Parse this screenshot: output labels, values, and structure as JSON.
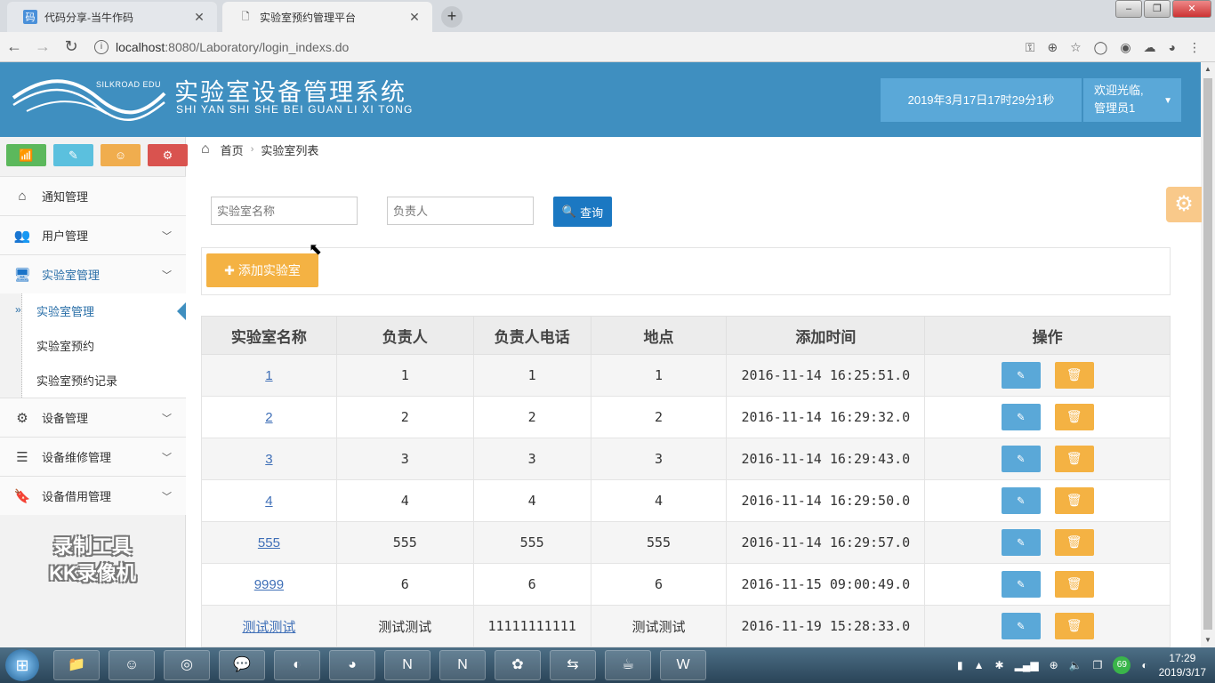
{
  "browser": {
    "tabs": [
      {
        "title": "代码分享-当牛作码",
        "active": false
      },
      {
        "title": "实验室预约管理平台",
        "active": true
      }
    ],
    "url_host": "localhost",
    "url_rest": ":8080/Laboratory/login_indexs.do"
  },
  "header": {
    "logo_text": "SILKROAD EDU",
    "title": "实验室设备管理系统",
    "subtitle": "SHI YAN SHI SHE BEI GUAN LI XI TONG",
    "datetime": "2019年3月17日17时29分1秒",
    "welcome": "欢迎光临,",
    "username": "管理员1"
  },
  "sidebar": {
    "menu": [
      {
        "label": "通知管理",
        "icon": "home-icon"
      },
      {
        "label": "用户管理",
        "icon": "users-icon"
      },
      {
        "label": "实验室管理",
        "icon": "desktop-icon"
      },
      {
        "label": "设备管理",
        "icon": "cogs-icon"
      },
      {
        "label": "设备维修管理",
        "icon": "list-icon"
      },
      {
        "label": "设备借用管理",
        "icon": "bookmark-icon"
      }
    ],
    "submenu": [
      "实验室管理",
      "实验室预约",
      "实验室预约记录"
    ],
    "watermark_line1": "录制工具",
    "watermark_line2": "KK录像机"
  },
  "breadcrumb": {
    "home": "首页",
    "current": "实验室列表"
  },
  "search": {
    "lab_placeholder": "实验室名称",
    "owner_placeholder": "负责人",
    "query_label": "查询"
  },
  "add_button": "添加实验室",
  "table": {
    "headers": [
      "实验室名称",
      "负责人",
      "负责人电话",
      "地点",
      "添加时间",
      "操作"
    ],
    "rows": [
      {
        "name": "1",
        "owner": "1",
        "phone": "1",
        "location": "1",
        "time": "2016-11-14 16:25:51.0"
      },
      {
        "name": "2",
        "owner": "2",
        "phone": "2",
        "location": "2",
        "time": "2016-11-14 16:29:32.0"
      },
      {
        "name": "3",
        "owner": "3",
        "phone": "3",
        "location": "3",
        "time": "2016-11-14 16:29:43.0"
      },
      {
        "name": "4",
        "owner": "4",
        "phone": "4",
        "location": "4",
        "time": "2016-11-14 16:29:50.0"
      },
      {
        "name": "555",
        "owner": "555",
        "phone": "555",
        "location": "555",
        "time": "2016-11-14 16:29:57.0"
      },
      {
        "name": "9999",
        "owner": "6",
        "phone": "6",
        "location": "6",
        "time": "2016-11-15 09:00:49.0"
      },
      {
        "name": "测试测试",
        "owner": "测试测试",
        "phone": "11111111111",
        "location": "测试测试",
        "time": "2016-11-19 15:28:33.0"
      }
    ]
  },
  "taskbar": {
    "time": "17:29",
    "date": "2019/3/17",
    "badge": "69"
  }
}
